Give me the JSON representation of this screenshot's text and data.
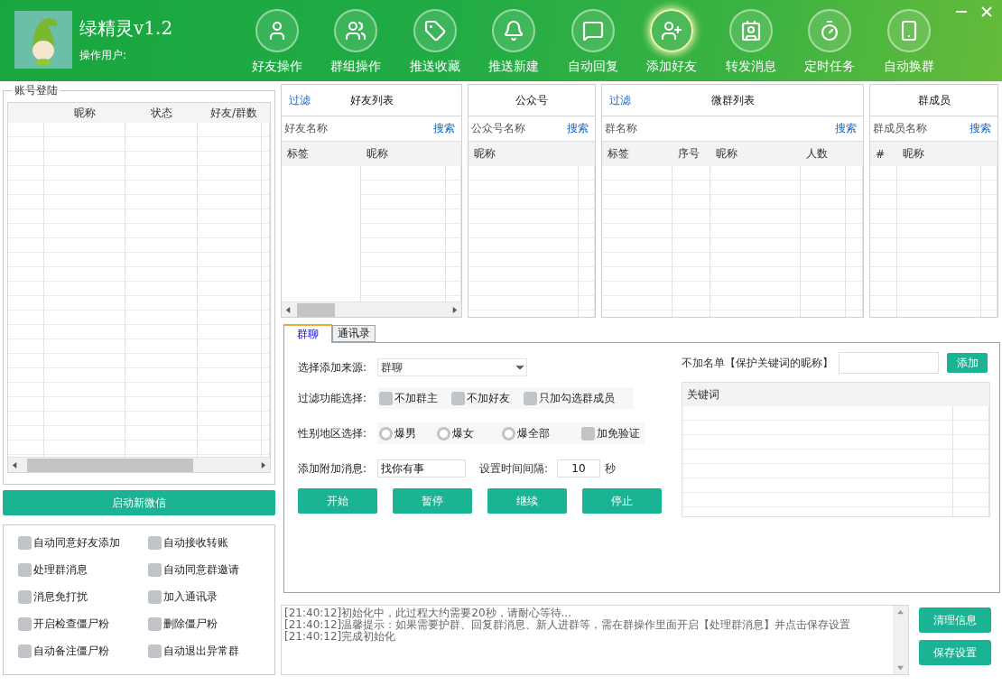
{
  "app": {
    "title": "绿精灵v1.2",
    "user_label": "操作用户:"
  },
  "toolbar": [
    {
      "label": "好友操作",
      "selected": false
    },
    {
      "label": "群组操作",
      "selected": false
    },
    {
      "label": "推送收藏",
      "selected": false
    },
    {
      "label": "推送新建",
      "selected": false
    },
    {
      "label": "自动回复",
      "selected": false
    },
    {
      "label": "添加好友",
      "selected": true
    },
    {
      "label": "转发消息",
      "selected": false
    },
    {
      "label": "定时任务",
      "selected": false
    },
    {
      "label": "自动换群",
      "selected": false
    }
  ],
  "account_panel": {
    "title": "账号登陆",
    "columns": [
      "昵称",
      "状态",
      "好友/群数"
    ]
  },
  "launch_button": "启动新微信",
  "options": [
    {
      "label": "自动同意好友添加",
      "checked": false
    },
    {
      "label": "自动接收转账",
      "checked": false
    },
    {
      "label": "处理群消息",
      "checked": false
    },
    {
      "label": "自动同意群邀请",
      "checked": false
    },
    {
      "label": "消息免打扰",
      "checked": false
    },
    {
      "label": "加入通讯录",
      "checked": false
    },
    {
      "label": "开启检查僵尸粉",
      "checked": false
    },
    {
      "label": "删除僵尸粉",
      "checked": false
    },
    {
      "label": "自动备注僵尸粉",
      "checked": false
    },
    {
      "label": "自动退出异常群",
      "checked": false
    }
  ],
  "lists": [
    {
      "filter": "过滤",
      "title": "好友列表",
      "search_label": "好友名称",
      "search_button": "搜索",
      "columns": [
        "标签",
        "昵称"
      ]
    },
    {
      "title": "公众号",
      "search_label": "公众号名称",
      "search_button": "搜索",
      "columns": [
        "昵称"
      ]
    },
    {
      "filter": "过滤",
      "title": "微群列表",
      "search_label": "群名称",
      "search_button": "搜索",
      "columns": [
        "标签",
        "序号",
        "昵称",
        "人数"
      ]
    },
    {
      "title": "群成员",
      "search_label": "群成员名称",
      "search_button": "搜索",
      "columns": [
        "#",
        "昵称"
      ]
    }
  ],
  "tabs": [
    {
      "label": "群聊",
      "selected": true
    },
    {
      "label": "通讯录",
      "selected": false
    }
  ],
  "form": {
    "source_label": "选择添加来源:",
    "source_value": "群聊",
    "filter_label": "过滤功能选择:",
    "filters": [
      {
        "label": "不加群主",
        "checked": false
      },
      {
        "label": "不加好友",
        "checked": false
      },
      {
        "label": "只加勾选群成员",
        "checked": false
      }
    ],
    "gender_label": "性别地区选择:",
    "gender_options": [
      {
        "kind": "radio",
        "label": "爆男",
        "selected": false
      },
      {
        "kind": "radio",
        "label": "爆女",
        "selected": false
      },
      {
        "kind": "radio",
        "label": "爆全部",
        "selected": false
      },
      {
        "kind": "checkbox",
        "label": "加免验证",
        "checked": false
      }
    ],
    "message_label": "添加附加消息:",
    "message_value": "找你有事",
    "interval_label": "设置时间间隔:",
    "interval_value": "10",
    "interval_unit": "秒",
    "buttons": [
      "开始",
      "暂停",
      "继续",
      "停止"
    ],
    "blacklist_label": "不加名单【保护关键词的昵称】",
    "add_button": "添加",
    "keyword_column": "关键词"
  },
  "log": {
    "lines": [
      "[21:40:12]初始化中，此过程大约需要20秒，请耐心等待...",
      "[21:40:12]温馨提示：如果需要护群、回复群消息、新人进群等，需在群操作里面开启【处理群消息】并点击保存设置",
      "[21:40:12]完成初始化"
    ]
  },
  "log_buttons": [
    "清理信息",
    "保存设置"
  ]
}
